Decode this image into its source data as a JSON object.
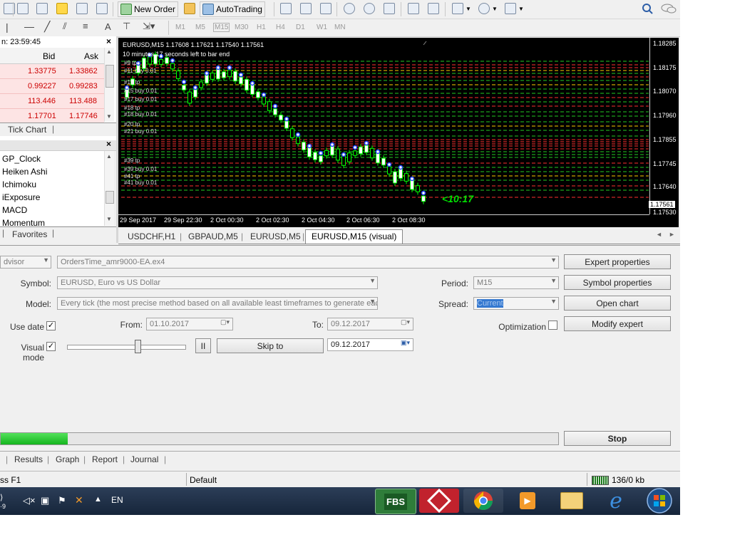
{
  "toolbar": {
    "new_order_label": "New Order",
    "autotrading_label": "AutoTrading",
    "timeframes": [
      "M1",
      "M5",
      "M15",
      "M30",
      "H1",
      "H4",
      "D1",
      "W1",
      "MN"
    ]
  },
  "market_watch": {
    "header_time": "n: 23:59:45",
    "col_bid": "Bid",
    "col_ask": "Ask",
    "rows": [
      {
        "bid": "1.33775",
        "ask": "1.33862"
      },
      {
        "bid": "0.99227",
        "ask": "0.99283"
      },
      {
        "bid": "113.446",
        "ask": "113.488"
      },
      {
        "bid": "1.17701",
        "ask": "1.17746"
      }
    ],
    "tab_tick_chart": "Tick Chart"
  },
  "navigator": {
    "items": [
      "GP_Clock",
      "Heiken Ashi",
      "Ichimoku",
      "iExposure",
      "MACD",
      "Momentum"
    ],
    "tab_favorites": "Favorites"
  },
  "chart": {
    "info_line": "EURUSD,M15  1.17608 1.17621 1.17540 1.17561",
    "timer_text": "10 minutes 17 seconds left to bar end",
    "countdown": "<10:17",
    "price_labels": [
      "1.18285",
      "1.18175",
      "1.18070",
      "1.17960",
      "1.17855",
      "1.17745",
      "1.17640",
      "1.17561",
      "1.17530"
    ],
    "time_labels": [
      "29 Sep 2017",
      "29 Sep 22:30",
      "2 Oct 00:30",
      "2 Oct 02:30",
      "2 Oct 04:30",
      "2 Oct 06:30",
      "2 Oct 08:30"
    ],
    "order_labels": [
      "#9 tp",
      "#11 buy 0.01",
      "#15 tp",
      "#15 buy 0.01",
      "#17 buy 0.01",
      "#18 tp",
      "#18 buy 0.01",
      "#20 tp",
      "#21 buy 0.01",
      "#39 tp",
      "#39 buy 0.01",
      "#41 tp",
      "#41 buy 0.01"
    ]
  },
  "chart_tabs": [
    "USDCHF,H1",
    "GBPAUD,M5",
    "EURUSD,M5",
    "EURUSD,M15 (visual)"
  ],
  "tester": {
    "advisor_label": "dvisor",
    "expert_file": "OrdersTime_amr9000-EA.ex4",
    "symbol_label": "Symbol:",
    "symbol_value": "EURUSD, Euro vs US Dollar",
    "model_label": "Model:",
    "model_value": "Every tick (the most precise method based on all available least timeframes to generate eac",
    "use_date_label": "Use date",
    "from_label": "From:",
    "from_value": "01.10.2017",
    "to_label": "To:",
    "to_value": "09.12.2017",
    "visual_mode_label": "Visual mode",
    "skip_to_label": "Skip to",
    "skip_to_date": "09.12.2017",
    "period_label": "Period:",
    "period_value": "M15",
    "spread_label": "Spread:",
    "spread_value": "Current",
    "optimization_label": "Optimization",
    "buttons": {
      "expert_properties": "Expert properties",
      "symbol_properties": "Symbol properties",
      "open_chart": "Open chart",
      "modify_expert": "Modify expert",
      "stop": "Stop",
      "pause": "II"
    },
    "progress": 0.12,
    "tabs": [
      "Results",
      "Graph",
      "Report",
      "Journal"
    ]
  },
  "status_bar": {
    "help_text": "ss F1",
    "profile": "Default",
    "traffic": "136/0 kb"
  },
  "taskbar": {
    "lang": "EN",
    "apps": [
      "FBS",
      "",
      "",
      "",
      "",
      "",
      ""
    ]
  }
}
